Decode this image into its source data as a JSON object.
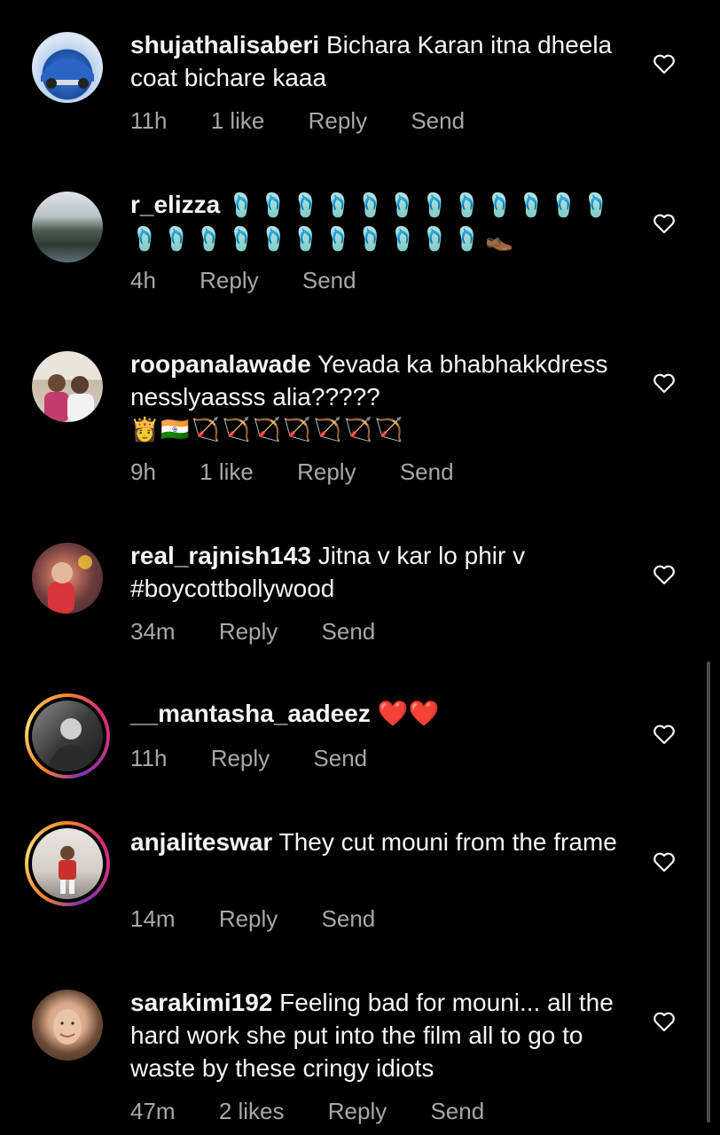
{
  "comments": [
    {
      "username": "shujathalisaberi",
      "text": "Bichara Karan itna dheela coat bichare kaaa",
      "time": "11h",
      "likes": "1 like",
      "reply": "Reply",
      "send": "Send"
    },
    {
      "username": "r_elizza",
      "text": "🩴🩴🩴🩴🩴🩴🩴🩴🩴🩴🩴🩴🩴🩴🩴🩴🩴🩴🩴🩴🩴🩴🩴👞",
      "time": "4h",
      "reply": "Reply",
      "send": "Send"
    },
    {
      "username": "roopanalawade",
      "text": "Yevada ka bhabhakkdress nesslyaasss alia?????",
      "emoji_line": "👸🇮🇳🏹🏹🏹🏹🏹🏹🏹",
      "time": "9h",
      "likes": "1 like",
      "reply": "Reply",
      "send": "Send"
    },
    {
      "username": "real_rajnish143",
      "text": "Jitna v kar lo phir v #boycottbollywood",
      "time": "34m",
      "reply": "Reply",
      "send": "Send"
    },
    {
      "username": "__mantasha_aadeez",
      "text": "❤️❤️",
      "time": "11h",
      "reply": "Reply",
      "send": "Send"
    },
    {
      "username": "anjaliteswar",
      "text": "They cut mouni from the frame",
      "time": "14m",
      "reply": "Reply",
      "send": "Send"
    },
    {
      "username": "sarakimi192",
      "text": "Feeling bad for mouni... all the hard work she put into the film all to go to waste by these cringy idiots",
      "time": "47m",
      "likes": "2 likes",
      "reply": "Reply",
      "send": "Send"
    }
  ],
  "colors": {
    "background": "#000000",
    "text": "#f5f5f5",
    "meta": "#a8a8a8"
  }
}
